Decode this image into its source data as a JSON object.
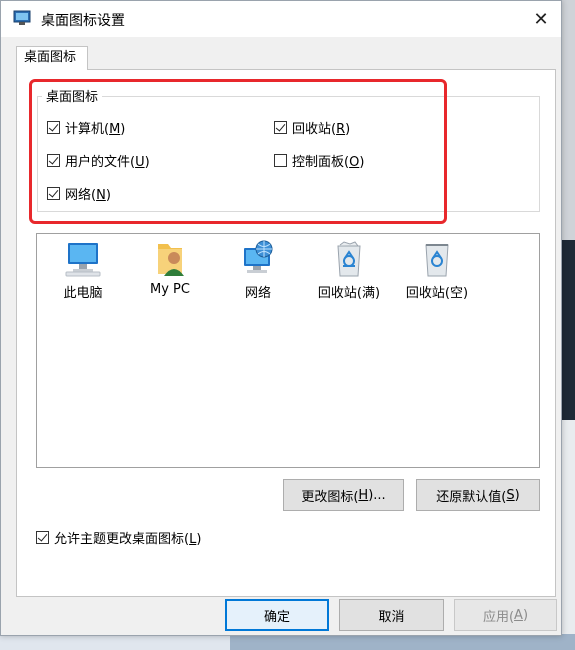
{
  "window": {
    "title": "桌面图标设置",
    "close_glyph": "✕"
  },
  "tab": {
    "label": "桌面图标"
  },
  "group": {
    "legend": "桌面图标",
    "items": [
      {
        "label": "计算机(",
        "key": "M",
        "suffix": ")",
        "checked": true
      },
      {
        "label": "回收站(",
        "key": "R",
        "suffix": ")",
        "checked": true
      },
      {
        "label": "用户的文件(",
        "key": "U",
        "suffix": ")",
        "checked": true
      },
      {
        "label": "控制面板(",
        "key": "O",
        "suffix": ")",
        "checked": false
      },
      {
        "label": "网络(",
        "key": "N",
        "suffix": ")",
        "checked": true
      }
    ]
  },
  "icons": [
    {
      "label": "此电脑",
      "icon": "monitor-icon"
    },
    {
      "label": "My PC",
      "icon": "user-folder-icon"
    },
    {
      "label": "网络",
      "icon": "network-icon"
    },
    {
      "label": "回收站(满)",
      "icon": "recycle-bin-full-icon"
    },
    {
      "label": "回收站(空)",
      "icon": "recycle-bin-empty-icon"
    }
  ],
  "buttons": {
    "change_icon": {
      "label": "更改图标(",
      "key": "H",
      "suffix": ")..."
    },
    "restore_default": {
      "label": "还原默认值(",
      "key": "S",
      "suffix": ")"
    },
    "ok": "确定",
    "cancel": "取消",
    "apply": {
      "label": "应用(",
      "key": "A",
      "suffix": ")"
    }
  },
  "allow_theme": {
    "label": "允许主题更改桌面图标(",
    "key": "L",
    "suffix": ")",
    "checked": true
  },
  "colors": {
    "highlight": "#e8282c",
    "primary_border": "#0078d7"
  }
}
